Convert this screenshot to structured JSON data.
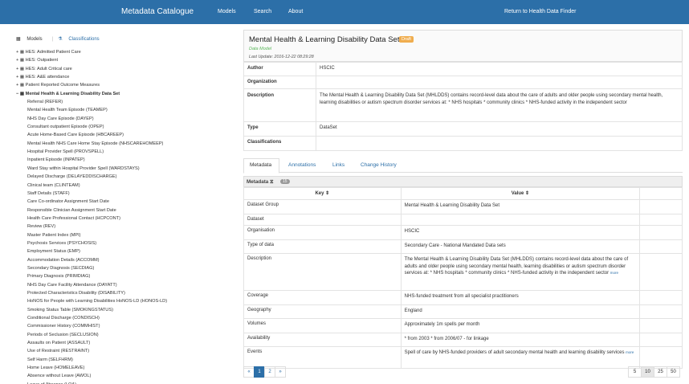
{
  "topbar": {
    "brand": "Metadata Catalogue",
    "models": "Models",
    "search": "Search",
    "about": "About",
    "return": "Return to Health Data Finder"
  },
  "left": {
    "tabs": {
      "models": "Models",
      "classifications": "Classifications"
    },
    "tree": [
      {
        "label": "+ ▦ HES: Admitted Patient Care",
        "kind": "top"
      },
      {
        "label": "+ ▦ HES: Outpatient",
        "kind": "top"
      },
      {
        "label": "+ ▦ HES: Adult Critical care",
        "kind": "top"
      },
      {
        "label": "+ ▦ HES: A&E attendance",
        "kind": "top"
      },
      {
        "label": "+ ▦ Patient Reported Outcome Measures",
        "kind": "top"
      },
      {
        "label": "− ▦ Mental Health & Learning Disability Data Set",
        "kind": "selected"
      },
      {
        "label": "Referral (REFER)",
        "kind": "child"
      },
      {
        "label": "Mental Health Team Episode (TEAMEP)",
        "kind": "child"
      },
      {
        "label": "NHS Day Care Episode (DAYEP)",
        "kind": "child"
      },
      {
        "label": "Consultant outpatient Episode (OPEP)",
        "kind": "child"
      },
      {
        "label": "Acute Home-Based Care Episode (HBCAREEP)",
        "kind": "child"
      },
      {
        "label": "Mental Health NHS Care Home Stay Episode (NHSCAREHOMEEP)",
        "kind": "child"
      },
      {
        "label": "Hospital Provider Spell (PROVSPELL)",
        "kind": "child"
      },
      {
        "label": "Inpatient Episode (INPATEP)",
        "kind": "child"
      },
      {
        "label": "Ward Stay within Hospital Provider Spell (WARDSTAYS)",
        "kind": "child"
      },
      {
        "label": "Delayed Discharge (DELAYEDDISCHARGE)",
        "kind": "child"
      },
      {
        "label": "Clinical team (CLINTEAM)",
        "kind": "child"
      },
      {
        "label": "Staff Details (STAFF)",
        "kind": "child"
      },
      {
        "label": "Care Co-ordinator Assignment Start Date",
        "kind": "child"
      },
      {
        "label": "Responsible Clinician Assignment Start Date",
        "kind": "child"
      },
      {
        "label": "Health Care Professional Contact (HCPCONT)",
        "kind": "child"
      },
      {
        "label": "Review (REV)",
        "kind": "child"
      },
      {
        "label": "Master Patient Index (MPI)",
        "kind": "child"
      },
      {
        "label": "Psychosis Services (PSYCHOSIS)",
        "kind": "child"
      },
      {
        "label": "Employment Status (EMP)",
        "kind": "child"
      },
      {
        "label": "Accommodation Details (ACCOMM)",
        "kind": "child"
      },
      {
        "label": "Secondary Diagnosis (SECDIAG)",
        "kind": "child"
      },
      {
        "label": "Primary Diagnosis (PRIMDIAG)",
        "kind": "child"
      },
      {
        "label": "NHS Day Care Facility Attendance (DAYATT)",
        "kind": "child"
      },
      {
        "label": "Protected Characteristics Disability (DISABILITY)",
        "kind": "child"
      },
      {
        "label": "HoNOS for People with Learning Disabilities HoNOS-LD (HONOS-LD)",
        "kind": "child"
      },
      {
        "label": "Smoking Status Table (SMOKINGSTATUS)",
        "kind": "child"
      },
      {
        "label": "Conditional Discharge (CONDISCH)",
        "kind": "child"
      },
      {
        "label": "Commissioner History (COMMHIST)",
        "kind": "child"
      },
      {
        "label": "Periods of Seclusion (SECLUSION)",
        "kind": "child"
      },
      {
        "label": "Assaults on Patient (ASSAULT)",
        "kind": "child"
      },
      {
        "label": "Use of Restraint (RESTRAINT)",
        "kind": "child"
      },
      {
        "label": "Self Harm (SELFHRM)",
        "kind": "child"
      },
      {
        "label": "Home Leave (HOMELEAVE)",
        "kind": "child"
      },
      {
        "label": "Absence without Leave (AWOL)",
        "kind": "child"
      },
      {
        "label": "Leave of Absence (LOA)",
        "kind": "child"
      }
    ]
  },
  "header": {
    "title": "Mental Health & Learning Disability Data Set",
    "badge": "Draft",
    "sub": "Data Model",
    "updated": "Last Update: 2016-12-22 08:29:28"
  },
  "props": {
    "author_k": "Author",
    "author_v": "HSCIC",
    "org_k": "Organization",
    "org_v": "",
    "desc_k": "Description",
    "desc_v": "The Mental Health & Learning Disability Data Set (MHLDDS) contains record-level data about the care of adults and older people using secondary mental health, learning disabilities or autism spectrum disorder services at: * NHS hospitals * community clinics * NHS-funded activity in the independent sector",
    "type_k": "Type",
    "type_v": "DataSet",
    "class_k": "Classifications",
    "class_v": ""
  },
  "subtabs": {
    "metadata": "Metadata",
    "annotations": "Annotations",
    "links": "Links",
    "history": "Change History"
  },
  "metadata": {
    "title": "Metadata ⧖",
    "count": "15",
    "col_key": "Key ⇕",
    "col_value": "Value ⇕",
    "more": "more",
    "rows": [
      {
        "k": "Dataset Group",
        "v": "Mental Health & Learning Disability Data Set"
      },
      {
        "k": "Dataset",
        "v": ""
      },
      {
        "k": "Organisation",
        "v": "HSCIC"
      },
      {
        "k": "Type of data",
        "v": "Secondary Care - National Mandated Data sets"
      },
      {
        "k": "Description",
        "v": "The Mental Health & Learning Disability Data Set (MHLDDS) contains record-level data about the care of adults and older people using secondary mental health, learning disabilities or autism spectrum disorder services at: * NHS hospitals * community clinics * NHS-funded activity in the independent sector"
      },
      {
        "k": "Coverage",
        "v": "NHS-funded treatment from all specialist practitioners"
      },
      {
        "k": "Geography",
        "v": "England"
      },
      {
        "k": "Volumes",
        "v": "Approximately 1m spells per month"
      },
      {
        "k": "Availability",
        "v": "* from 2003 * from 2006/07 - for linkage"
      },
      {
        "k": "Events",
        "v": "Spell of care by NHS-funded providers of adult secondary mental health and learning disability services"
      }
    ]
  },
  "pager": {
    "prev": "«",
    "p1": "1",
    "p2": "2",
    "next": "»"
  },
  "sizes": [
    "5",
    "10",
    "25",
    "50"
  ]
}
